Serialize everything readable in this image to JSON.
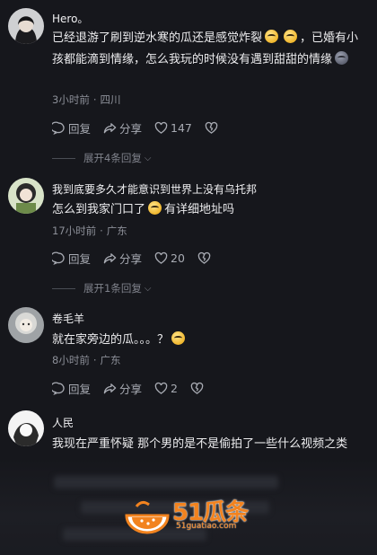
{
  "comments": [
    {
      "name": "Hero。",
      "text_parts": [
        "已经退游了刷到逆水寒的瓜还是感觉炸裂",
        "，已婚有小孩都能滴到情缘，怎么我玩的时候没有遇到甜甜的情缘"
      ],
      "time": "3小时前",
      "location": "四川",
      "reply_label": "回复",
      "share_label": "分享",
      "likes": "147",
      "expand_label": "展开4条回复"
    },
    {
      "name": "我到底要多久才能意识到世界上没有乌托邦",
      "text_parts": [
        "怎么到我家门口了",
        "有详细地址吗"
      ],
      "time": "17小时前",
      "location": "广东",
      "reply_label": "回复",
      "share_label": "分享",
      "likes": "20",
      "expand_label": "展开1条回复"
    },
    {
      "name": "卷毛羊",
      "text_parts": [
        "就在家旁边的瓜。。。？"
      ],
      "time": "8小时前",
      "location": "广东",
      "reply_label": "回复",
      "share_label": "分享",
      "likes": "2"
    },
    {
      "name": "人民",
      "text_parts": [
        "我现在严重怀疑 那个男的是不是偷拍了一些什么视频之类的？？ 怎么会突然这样，我真要跟那男的拼了"
      ]
    }
  ],
  "icons": {
    "reply": "reply-bubble-icon",
    "share": "share-arrow-icon",
    "like": "heart-icon",
    "dislike": "broken-heart-icon",
    "emoji": "emoji-icon"
  },
  "watermark": {
    "brand": "51瓜条",
    "url": "51guatiao.com"
  },
  "colors": {
    "background": "#16171c",
    "watermark": "#f2831f"
  }
}
